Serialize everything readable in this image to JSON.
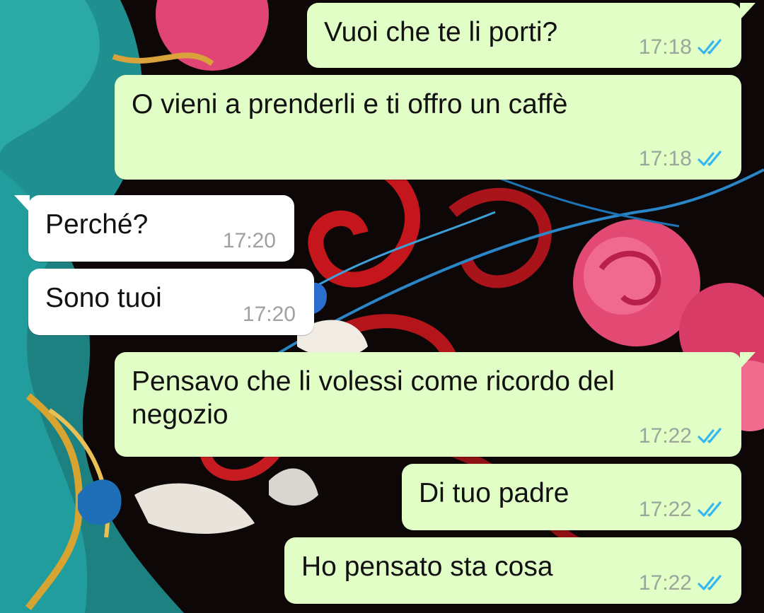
{
  "chat": {
    "accent_tick_color": "#34b7f1",
    "outgoing_bubble_color": "#e1fec6",
    "incoming_bubble_color": "#ffffff",
    "messages": [
      {
        "direction": "out",
        "text": "Vuoi che te li porti?",
        "time": "17:18",
        "status_icon": "double-check-read-icon"
      },
      {
        "direction": "out",
        "text": "O vieni a prenderli e ti offro un caffè",
        "time": "17:18",
        "status_icon": "double-check-read-icon"
      },
      {
        "direction": "in",
        "text": "Perché?",
        "time": "17:20"
      },
      {
        "direction": "in",
        "text": "Sono tuoi",
        "time": "17:20"
      },
      {
        "direction": "out",
        "text": "Pensavo che li volessi come ricordo del\nnegozio",
        "time": "17:22",
        "status_icon": "double-check-read-icon"
      },
      {
        "direction": "out",
        "text": "Di tuo padre",
        "time": "17:22",
        "status_icon": "double-check-read-icon"
      },
      {
        "direction": "out",
        "text": "Ho pensato sta cosa",
        "time": "17:22",
        "status_icon": "double-check-read-icon"
      }
    ]
  }
}
